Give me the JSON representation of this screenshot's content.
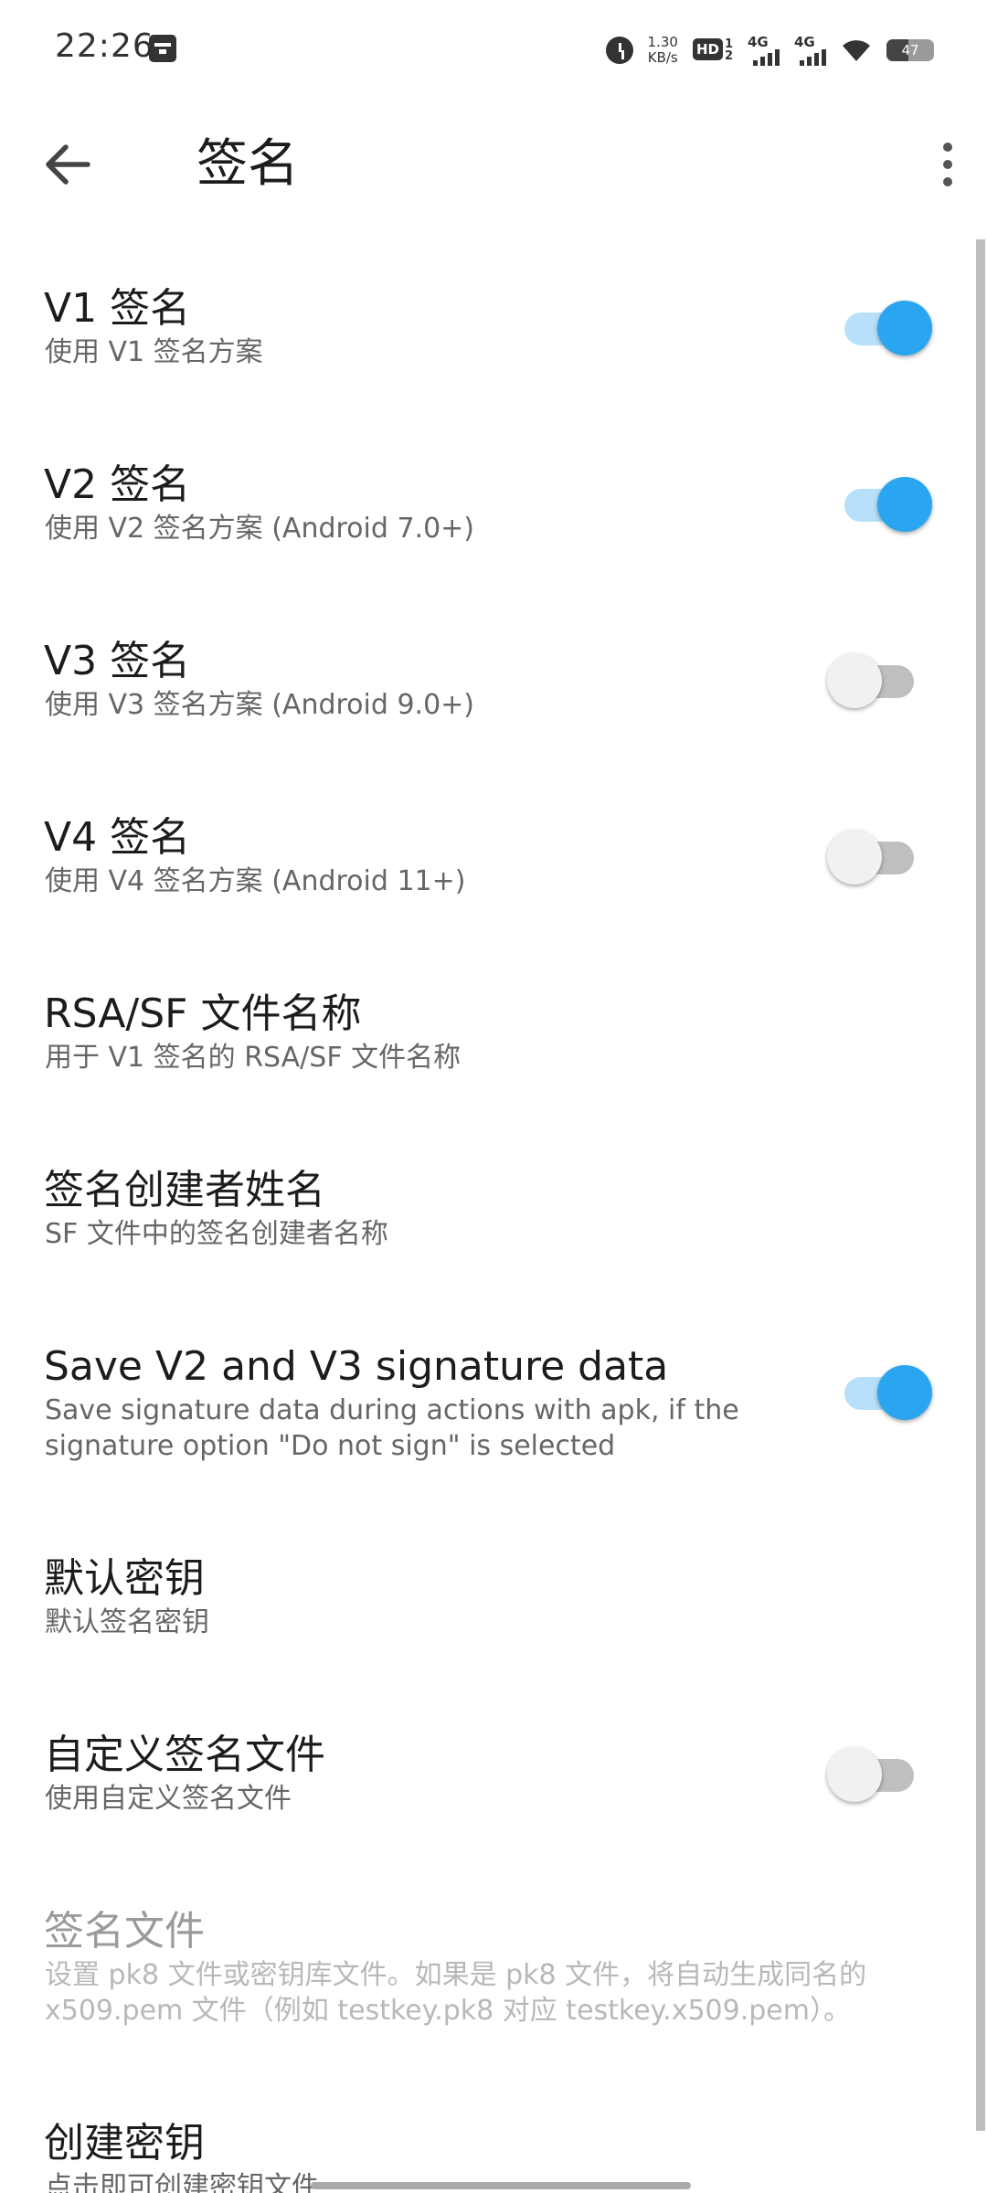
{
  "status_bar": {
    "time": "22:26",
    "net_speed_value": "1.30",
    "net_speed_unit": "KB/s",
    "hd_label": "HD",
    "hd_sup_top": "1",
    "hd_sup_bottom": "2",
    "signal_1_label": "4G",
    "signal_2_label": "4G",
    "battery_level": "47",
    "battery_fraction": 0.47
  },
  "app_bar": {
    "title": "签名"
  },
  "settings": [
    {
      "title": "V1 签名",
      "summary": "使用 V1 签名方案",
      "switch_on": true
    },
    {
      "title": "V2 签名",
      "summary": "使用 V2 签名方案 (Android 7.0+)",
      "switch_on": true
    },
    {
      "title": "V3 签名",
      "summary": "使用 V3 签名方案 (Android 9.0+)",
      "switch_on": false
    },
    {
      "title": "V4 签名",
      "summary": "使用 V4 签名方案 (Android 11+)",
      "switch_on": false
    },
    {
      "title": "RSA/SF 文件名称",
      "summary": "用于 V1 签名的 RSA/SF 文件名称"
    },
    {
      "title": "签名创建者姓名",
      "summary": "SF 文件中的签名创建者名称"
    },
    {
      "title": "Save V2 and V3 signature data",
      "summary_line1": "Save signature data during actions with apk, if the",
      "summary_line2": "signature option \"Do not sign\" is selected",
      "switch_on": true
    },
    {
      "title": "默认密钥",
      "summary": "默认签名密钥"
    },
    {
      "title": "自定义签名文件",
      "summary": "使用自定义签名文件",
      "switch_on": false
    },
    {
      "title": "签名文件",
      "summary_line1": "设置 pk8 文件或密钥库文件。如果是 pk8 文件，将自动生成同名的",
      "summary_line2": "x509.pem 文件（例如 testkey.pk8 对应 testkey.x509.pem）。",
      "enabled": false
    },
    {
      "title": "创建密钥",
      "summary": "点击即可创建密钥文件"
    }
  ]
}
